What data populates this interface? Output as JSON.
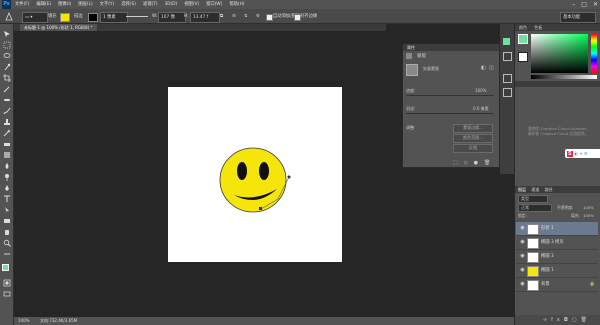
{
  "app": {
    "logo": "Ps"
  },
  "menubar": {
    "items": [
      "文件(F)",
      "编辑(E)",
      "图像(I)",
      "图层(L)",
      "文字(Y)",
      "选择(S)",
      "滤镜(T)",
      "3D(D)",
      "视图(V)",
      "窗口(W)",
      "帮助(H)"
    ],
    "window_controls": [
      "–",
      "□",
      "✕"
    ]
  },
  "options_bar": {
    "fill_label": "填充",
    "stroke_label": "描边",
    "stroke_width": "1 像素",
    "w_label": "W:",
    "w_value": "107 像",
    "h_label": "H:",
    "h_value": "13.47 f",
    "align_edges": "自动添加/删除",
    "align_edges2": "对齐边缘",
    "workspace": "基本功能"
  },
  "document": {
    "tab_label": "未标题-1 @ 100% (形状 1, RGB/8) *"
  },
  "status": {
    "zoom": "100%",
    "doc_info": "文档:732.4K/3.65M"
  },
  "properties": {
    "title": "属性",
    "panel": "蒙版",
    "pixel_mask": "矢量蒙版",
    "density_label": "浓度:",
    "density_value": "100%",
    "feather_label": "羽化:",
    "feather_value": "0.0 像素",
    "refine_label": "调整:",
    "btn_edge": "蒙版边缘...",
    "btn_color": "颜色范围...",
    "btn_invert": "反相"
  },
  "color_panel": {
    "tabs": [
      "颜色",
      "色板"
    ]
  },
  "libraries": {
    "hint1": "要使用 Creative Cloud Libraries,",
    "hint2": "请安装 Creative Cloud 应用程序。",
    "ime": "S"
  },
  "layers_panel": {
    "tabs": [
      "图层",
      "通道",
      "路径"
    ],
    "kind_label": "类型",
    "blend_mode": "正常",
    "opacity_label": "不透明度:",
    "opacity_value": "100%",
    "lock_label": "锁定:",
    "fill_label": "填充:",
    "fill_value": "100%",
    "layers": [
      {
        "name": "形状 1",
        "selected": true
      },
      {
        "name": "椭圆 3 拷贝",
        "selected": false
      },
      {
        "name": "椭圆 3",
        "selected": false
      },
      {
        "name": "椭圆 1",
        "selected": false
      },
      {
        "name": "背景",
        "selected": false
      }
    ]
  },
  "colors": {
    "accent": "#31a8ff",
    "face": "#f5e50a",
    "selected_layer": "#6b7a8f"
  }
}
